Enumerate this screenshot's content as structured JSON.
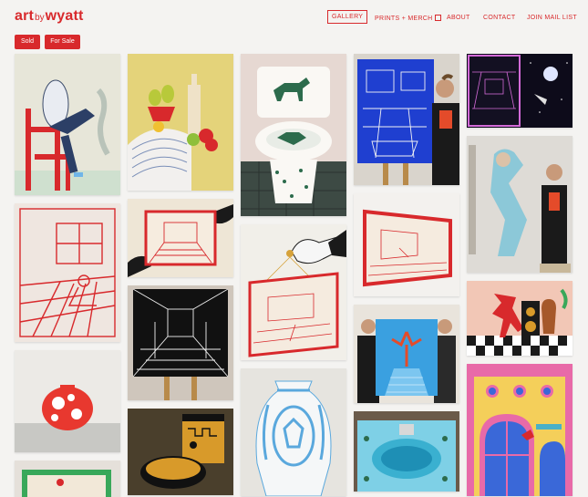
{
  "header": {
    "logo": {
      "part1": "art",
      "part2": "by",
      "part3": "wyatt"
    },
    "nav": [
      {
        "label": "GALLERY",
        "active": true
      },
      {
        "label": "PRINTS + MERCH",
        "external": true
      },
      {
        "label": "ABOUT"
      },
      {
        "label": "CONTACT"
      },
      {
        "label": "JOIN MAIL LIST"
      }
    ]
  },
  "filters": [
    {
      "label": "Sold"
    },
    {
      "label": "For Sale"
    }
  ],
  "colors": {
    "brand": "#d8292c",
    "background": "#f4f3f1"
  },
  "gallery": [
    {
      "subject": "figure on red chair"
    },
    {
      "subject": "red room line drawing"
    },
    {
      "subject": "red polka dot vase"
    },
    {
      "subject": "green framed painting"
    },
    {
      "subject": "still life with pears and bottle"
    },
    {
      "subject": "hands holding red framed drawing"
    },
    {
      "subject": "black and white room on easel"
    },
    {
      "subject": "greek pattern toilet"
    },
    {
      "subject": "painted toilet with dog"
    },
    {
      "subject": "hand hanging framed drawing"
    },
    {
      "subject": "blue figure vase"
    },
    {
      "subject": "blue painting with artist"
    },
    {
      "subject": "red frame perspective drawing"
    },
    {
      "subject": "two men holding blue painting"
    },
    {
      "subject": "painted sink"
    },
    {
      "subject": "purple night room painting"
    },
    {
      "subject": "blue figure cutout with man"
    },
    {
      "subject": "red dancer with speakers"
    },
    {
      "subject": "pink arched windows painting"
    }
  ]
}
